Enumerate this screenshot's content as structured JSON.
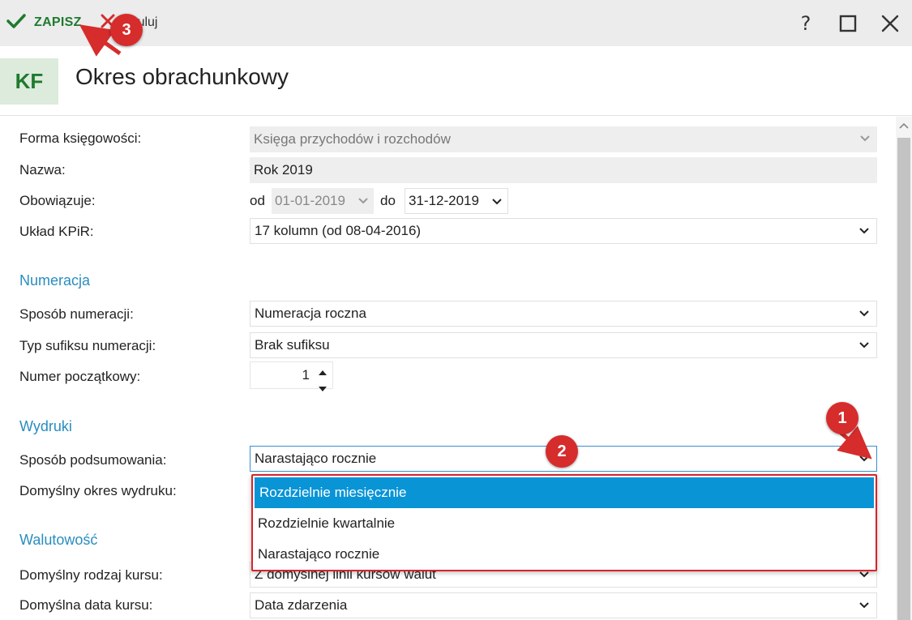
{
  "toolbar": {
    "save_label": "ZAPISZ",
    "cancel_label": "Anuluj",
    "help_glyph": "?"
  },
  "header": {
    "badge": "KF",
    "title": "Okres obrachunkowy"
  },
  "form": {
    "forma_label": "Forma księgowości:",
    "forma_value": "Księga przychodów i rozchodów",
    "nazwa_label": "Nazwa:",
    "nazwa_value": "Rok 2019",
    "obowiazuje_label": "Obowiązuje:",
    "od_label": "od",
    "od_value": "01-01-2019",
    "do_label": "do",
    "do_value": "31-12-2019",
    "uklad_label": "Układ KPiR:",
    "uklad_value": "17 kolumn (od 08-04-2016)",
    "numeracja_section": "Numeracja",
    "sposob_num_label": "Sposób numeracji:",
    "sposob_num_value": "Numeracja roczna",
    "typ_sufiksu_label": "Typ sufiksu numeracji:",
    "typ_sufiksu_value": "Brak sufiksu",
    "numer_pocz_label": "Numer początkowy:",
    "numer_pocz_value": "1",
    "wydruki_section": "Wydruki",
    "sposob_pods_label": "Sposób podsumowania:",
    "sposob_pods_value": "Narastająco rocznie",
    "domyslny_okres_label": "Domyślny okres wydruku:",
    "walutowosc_section": "Walutowość",
    "rodzaj_kursu_label": "Domyślny rodzaj kursu:",
    "rodzaj_kursu_value": "Z domyślnej linii kursów walut",
    "data_kursu_label": "Domyślna data kursu:",
    "data_kursu_value": "Data zdarzenia"
  },
  "dropdown": {
    "options": [
      "Rozdzielnie miesięcznie",
      "Rozdzielnie kwartalnie",
      "Narastająco rocznie"
    ],
    "highlighted": "Rozdzielnie miesięcznie"
  },
  "markers": [
    "1",
    "2",
    "3"
  ],
  "colors": {
    "accent_green": "#1f7a2e",
    "section_blue": "#2a8dc0",
    "highlight_blue": "#0994d6",
    "annotation_red": "#d62c2c"
  }
}
